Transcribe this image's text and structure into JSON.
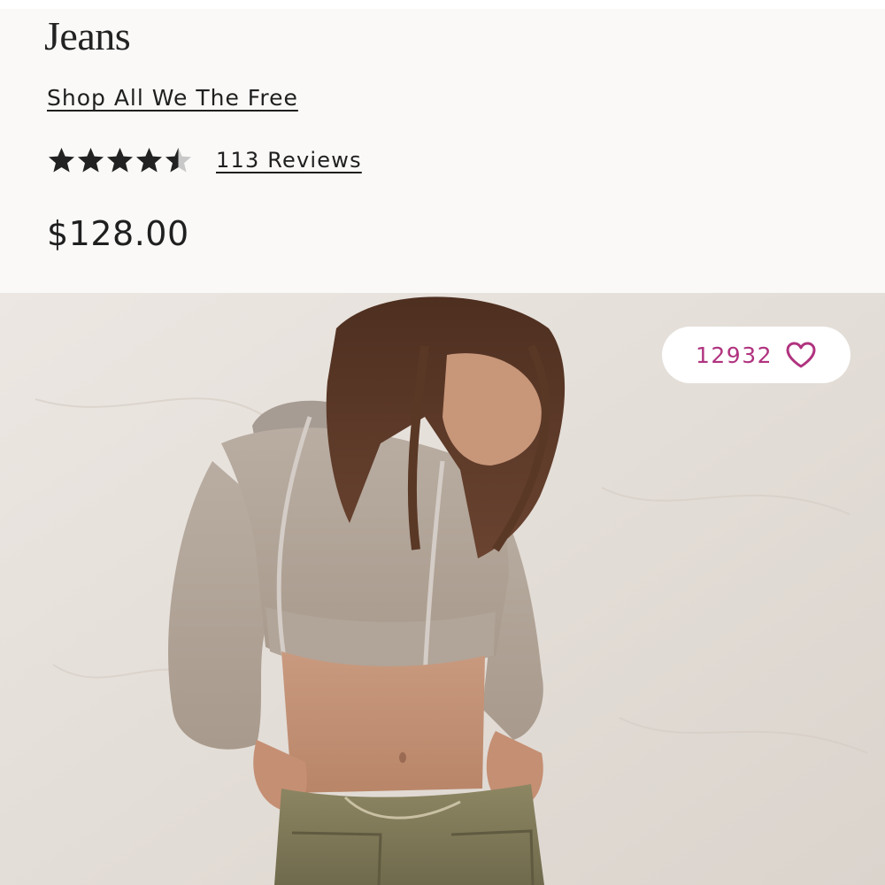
{
  "product": {
    "title": "Jeans",
    "shop_link": "Shop All We The Free",
    "rating": 4.5,
    "rating_max": 5,
    "reviews_label": "113 Reviews",
    "price": "$128.00"
  },
  "hero": {
    "image_alt": "Model wearing a cropped hoodie and olive cargo pants",
    "like_count": "12932",
    "like_icon": "heart-outline-icon"
  },
  "colors": {
    "panel_bg": "#faf9f7",
    "text": "#1f1f1f",
    "star_filled": "#222222",
    "star_empty": "#c8c8c8",
    "accent": "#b0337f"
  }
}
